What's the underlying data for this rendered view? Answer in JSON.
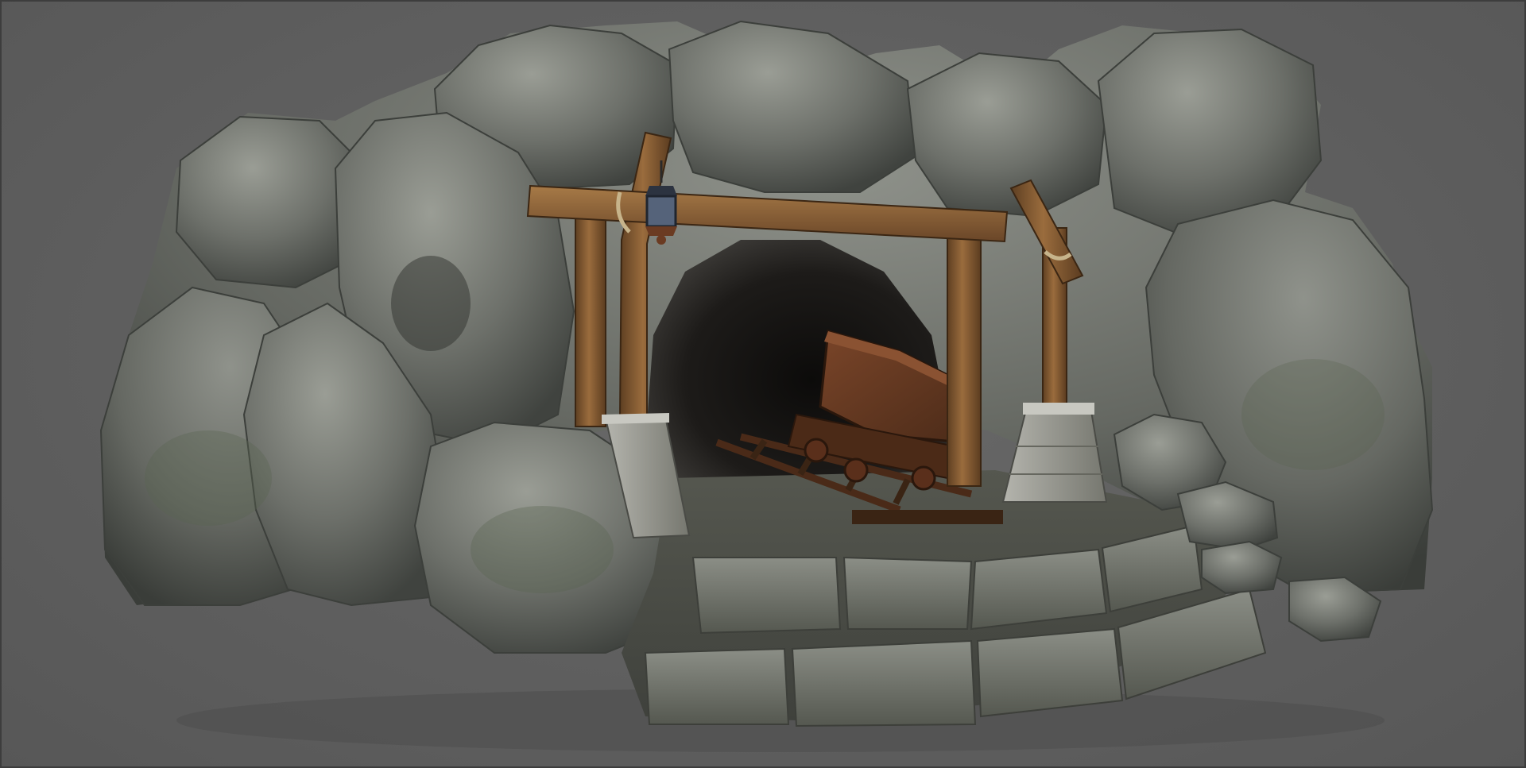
{
  "viewport": {
    "background_color": "#5e5e5e",
    "border_color": "#3d3d3d"
  },
  "scene": {
    "subject": "mine-entrance",
    "elements": [
      "rock-cliff",
      "mine-tunnel",
      "wooden-frame",
      "lantern",
      "mine-cart",
      "rail-tracks",
      "stone-pillar-base",
      "stone-floor-platform",
      "loose-boulders"
    ],
    "colors": {
      "rock_light": "#8c8f88",
      "rock_mid": "#6c6f69",
      "rock_dark": "#3f423e",
      "moss": "#5a6450",
      "wood": "#8a5f35",
      "wood_dark": "#5b3c20",
      "rust": "#6b3b22",
      "tunnel": "#161514",
      "stone_block": "#a3a39c",
      "lantern_metal": "#2c3340"
    }
  }
}
